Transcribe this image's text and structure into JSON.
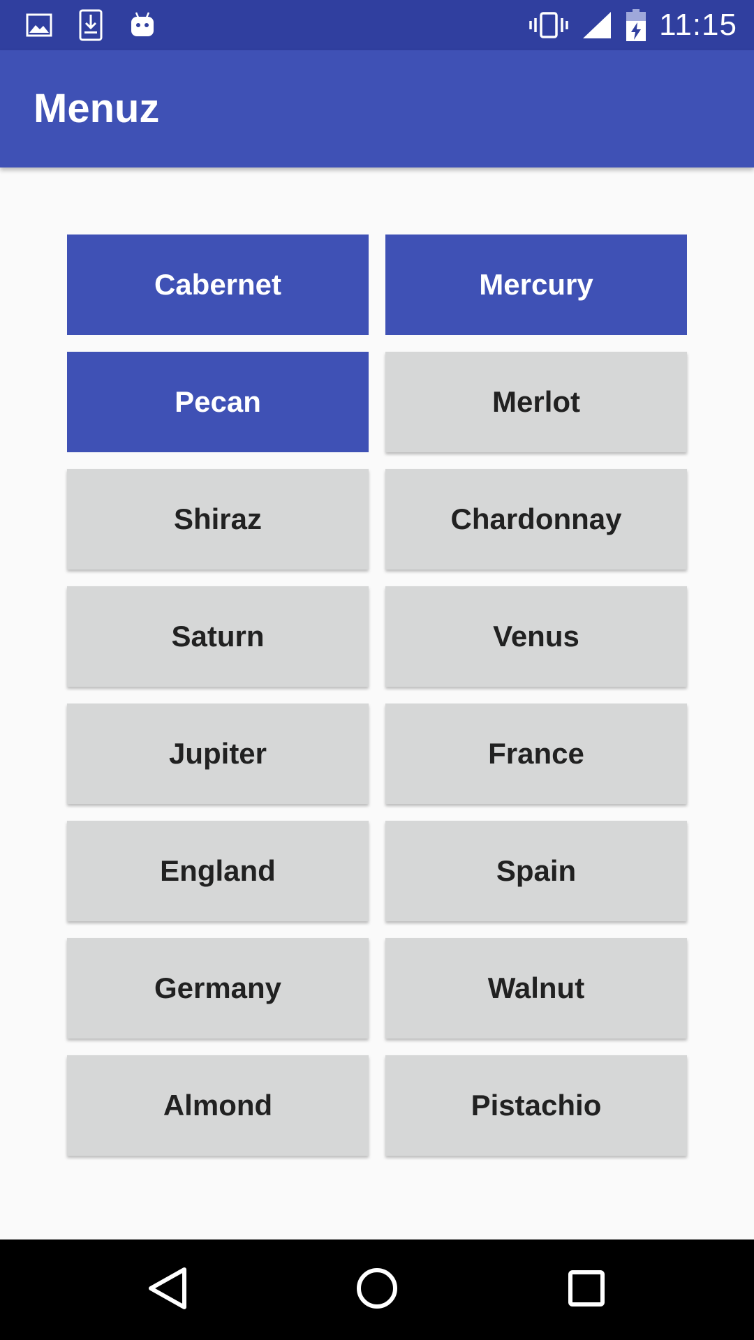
{
  "status_bar": {
    "time": "11:15",
    "left_icons": [
      "image-icon",
      "download-icon",
      "android-icon"
    ],
    "right_icons": [
      "vibrate-icon",
      "signal-icon",
      "battery-charging-icon"
    ]
  },
  "app_bar": {
    "title": "Menuz"
  },
  "colors": {
    "primary": "#3f51b5",
    "primary_dark": "#303f9f",
    "button_default": "#d6d7d7",
    "text_dark": "#212121"
  },
  "buttons": [
    {
      "label": "Cabernet",
      "selected": true
    },
    {
      "label": "Mercury",
      "selected": true
    },
    {
      "label": "Pecan",
      "selected": true
    },
    {
      "label": "Merlot",
      "selected": false
    },
    {
      "label": "Shiraz",
      "selected": false
    },
    {
      "label": "Chardonnay",
      "selected": false
    },
    {
      "label": "Saturn",
      "selected": false
    },
    {
      "label": "Venus",
      "selected": false
    },
    {
      "label": "Jupiter",
      "selected": false
    },
    {
      "label": "France",
      "selected": false
    },
    {
      "label": "England",
      "selected": false
    },
    {
      "label": "Spain",
      "selected": false
    },
    {
      "label": "Germany",
      "selected": false
    },
    {
      "label": "Walnut",
      "selected": false
    },
    {
      "label": "Almond",
      "selected": false
    },
    {
      "label": "Pistachio",
      "selected": false
    }
  ],
  "nav_bar": {
    "icons": [
      "back-icon",
      "home-icon",
      "recents-icon"
    ]
  }
}
